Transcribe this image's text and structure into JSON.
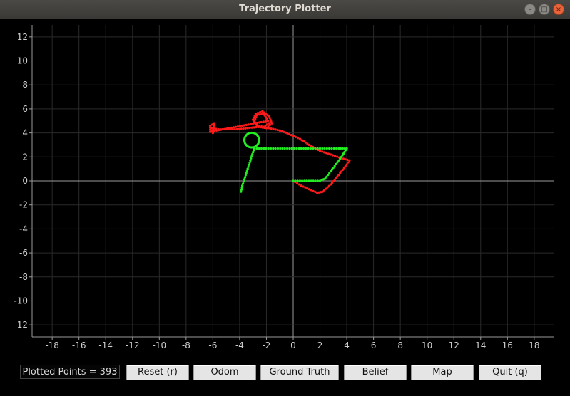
{
  "window": {
    "title": "Trajectory Plotter"
  },
  "chart_data": {
    "type": "scatter",
    "xlim": [
      -19.5,
      19.5
    ],
    "ylim": [
      -13,
      13
    ],
    "x_ticks": [
      -18,
      -16,
      -14,
      -12,
      -10,
      -8,
      -6,
      -4,
      -2,
      0,
      2,
      4,
      6,
      8,
      10,
      12,
      14,
      16,
      18
    ],
    "y_ticks": [
      12,
      10,
      8,
      6,
      4,
      2,
      0,
      -2,
      -4,
      -6,
      -8,
      -10,
      -12
    ],
    "grid": true,
    "colors": {
      "background": "#000000",
      "grid": "#2a2a2a",
      "axis": "#9a9a9a",
      "tick_label": "#cfcfcf"
    },
    "series": [
      {
        "color": "#ff1a1a",
        "points": [
          [
            0,
            0
          ],
          [
            0.6,
            -0.4
          ],
          [
            1.2,
            -0.7
          ],
          [
            1.8,
            -1.0
          ],
          [
            2.2,
            -0.9
          ],
          [
            2.8,
            -0.3
          ],
          [
            3.4,
            0.5
          ],
          [
            3.9,
            1.2
          ],
          [
            4.2,
            1.7
          ],
          [
            3.6,
            1.9
          ],
          [
            2.8,
            2.2
          ],
          [
            2.0,
            2.5
          ],
          [
            1.2,
            3.0
          ],
          [
            0.5,
            3.5
          ],
          [
            -0.3,
            3.9
          ],
          [
            -1.0,
            4.2
          ],
          [
            -1.8,
            4.4
          ],
          [
            -2.6,
            4.5
          ],
          [
            -3.4,
            4.4
          ],
          [
            -4.2,
            4.3
          ],
          [
            -5.0,
            4.3
          ],
          [
            -5.6,
            4.3
          ],
          [
            -6.1,
            4.4
          ],
          [
            -6.0,
            4.0
          ],
          [
            -5.9,
            4.8
          ],
          [
            -6.2,
            4.6
          ],
          [
            -6.2,
            4.1
          ],
          [
            -1.9,
            5.0
          ],
          [
            -2.2,
            5.6
          ],
          [
            -2.7,
            5.5
          ],
          [
            -2.9,
            5.0
          ],
          [
            -2.6,
            4.5
          ],
          [
            -2.0,
            4.4
          ],
          [
            -1.6,
            4.8
          ],
          [
            -1.8,
            5.4
          ],
          [
            -2.3,
            5.8
          ],
          [
            -2.8,
            5.6
          ],
          [
            -3.0,
            5.1
          ],
          [
            -2.7,
            4.6
          ],
          [
            -2.2,
            4.5
          ],
          [
            -1.7,
            4.9
          ]
        ]
      },
      {
        "color": "#22ee22",
        "points": [
          [
            0,
            0
          ],
          [
            0.5,
            0
          ],
          [
            1.0,
            0
          ],
          [
            1.5,
            0
          ],
          [
            2.0,
            0
          ],
          [
            2.4,
            0.2
          ],
          [
            2.8,
            0.8
          ],
          [
            3.2,
            1.4
          ],
          [
            3.6,
            2.0
          ],
          [
            4.0,
            2.7
          ],
          [
            3.4,
            2.7
          ],
          [
            2.7,
            2.7
          ],
          [
            2.0,
            2.7
          ],
          [
            1.3,
            2.7
          ],
          [
            0.6,
            2.7
          ],
          [
            -0.1,
            2.7
          ],
          [
            -0.8,
            2.7
          ],
          [
            -1.5,
            2.7
          ],
          [
            -2.2,
            2.7
          ],
          [
            -2.9,
            2.7
          ],
          [
            -3.0,
            2.4
          ],
          [
            -3.2,
            1.7
          ],
          [
            -3.4,
            1.0
          ],
          [
            -3.6,
            0.3
          ],
          [
            -3.8,
            -0.4
          ],
          [
            -3.9,
            -0.9
          ]
        ],
        "circle": {
          "cx": -3.1,
          "cy": 3.4,
          "r": 0.55
        }
      }
    ]
  },
  "controls": {
    "plotted_points": "Plotted Points = 393",
    "reset": "Reset (r)",
    "odom": "Odom",
    "ground_truth": "Ground Truth",
    "belief": "Belief",
    "map": "Map",
    "quit": "Quit (q)"
  }
}
